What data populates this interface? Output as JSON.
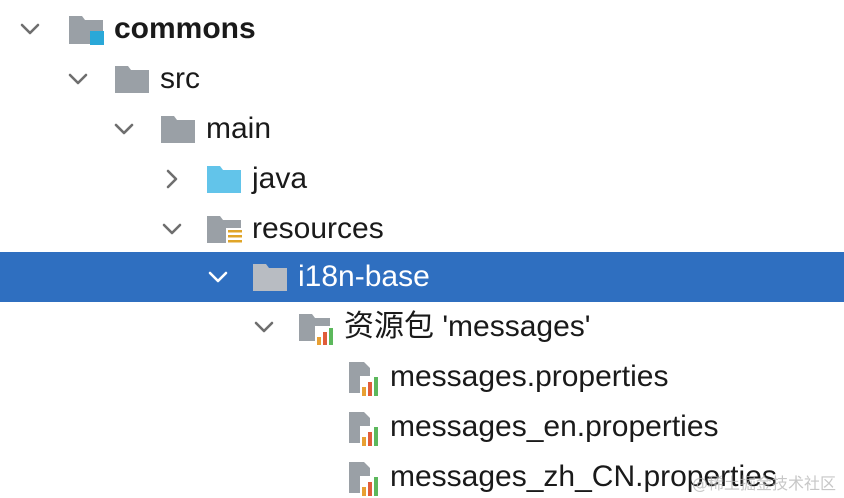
{
  "tree": {
    "items": [
      {
        "label": "commons"
      },
      {
        "label": "src"
      },
      {
        "label": "main"
      },
      {
        "label": "java"
      },
      {
        "label": "resources"
      },
      {
        "label": "i18n-base"
      },
      {
        "label": "资源包 'messages'"
      },
      {
        "label": "messages.properties"
      },
      {
        "label": "messages_en.properties"
      },
      {
        "label": "messages_zh_CN.properties"
      }
    ]
  },
  "watermark": "@稀土掘金技术社区",
  "colors": {
    "selection": "#2f6fc0",
    "folder_gray": "#9aa0a6",
    "folder_blue": "#62c4ea",
    "module_marker": "#2aa8d8"
  }
}
